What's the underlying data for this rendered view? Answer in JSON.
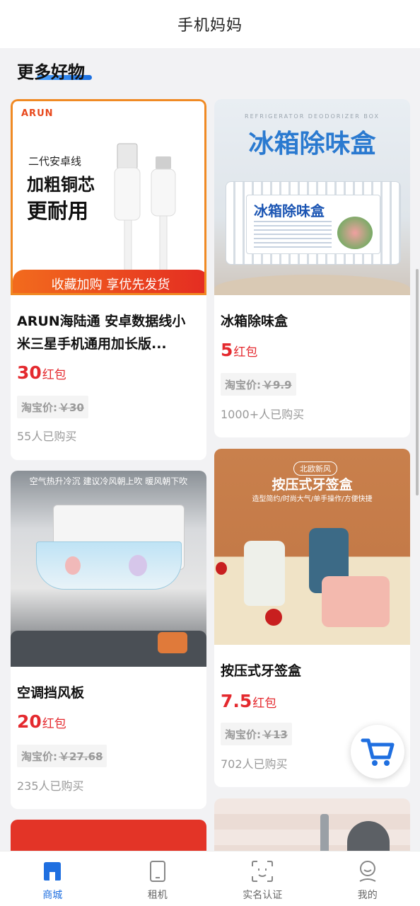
{
  "header": {
    "title": "手机妈妈"
  },
  "section": {
    "title": "更多好物"
  },
  "products": [
    {
      "name": "ARUN海陆通 安卓数据线小米三星手机通用加长版...",
      "price": "30",
      "price_unit": "红包",
      "taobao_label": "淘宝价:",
      "taobao_price": "￥30",
      "sold": "55人已购买",
      "image": {
        "brand": "ARUN",
        "line1": "二代安卓线",
        "line2": "加粗铜芯",
        "line3": "更耐用",
        "banner": "收藏加购 享优先发货"
      }
    },
    {
      "name": "冰箱除味盒",
      "price": "5",
      "price_unit": "红包",
      "taobao_label": "淘宝价:",
      "taobao_price": "￥9.9",
      "sold": "1000+人已购买",
      "image": {
        "sub": "REFRIGERATOR DEODORIZER BOX",
        "headline": "冰箱除味盒",
        "box_text": "冰箱除味盒"
      }
    },
    {
      "name": "空调挡风板",
      "price": "20",
      "price_unit": "红包",
      "taobao_label": "淘宝价:",
      "taobao_price": "￥27.68",
      "sold": "235人已购买",
      "image": {
        "caption": "空气热升冷沉 建议冷风朝上吹 暖风朝下吹"
      }
    },
    {
      "name": "按压式牙签盒",
      "price": "7.5",
      "price_unit": "红包",
      "taobao_label": "淘宝价:",
      "taobao_price": "￥13",
      "sold": "702人已购买",
      "image": {
        "tag": "北欧新风",
        "headline": "按压式牙签盒",
        "sub": "造型简约/时尚大气/单手操作/方便快捷"
      }
    }
  ],
  "tabs": [
    {
      "label": "商城",
      "icon": "shop-icon",
      "active": true
    },
    {
      "label": "租机",
      "icon": "phone-icon",
      "active": false
    },
    {
      "label": "实名认证",
      "icon": "face-id-icon",
      "active": false
    },
    {
      "label": "我的",
      "icon": "profile-icon",
      "active": false
    }
  ],
  "colors": {
    "accent": "#1f6fe0",
    "price": "#e4292e"
  }
}
